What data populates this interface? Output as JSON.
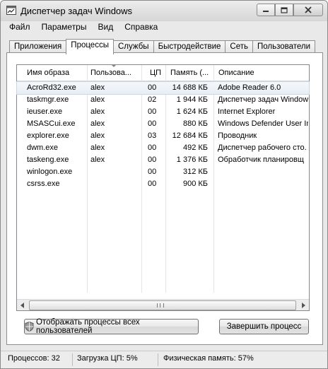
{
  "window": {
    "title": "Диспетчер задач Windows"
  },
  "menu": [
    "Файл",
    "Параметры",
    "Вид",
    "Справка"
  ],
  "tabs": [
    "Приложения",
    "Процессы",
    "Службы",
    "Быстродействие",
    "Сеть",
    "Пользователи"
  ],
  "active_tab": "Процессы",
  "columns": [
    "Имя образа",
    "Пользова...",
    "ЦП",
    "Память (...",
    "Описание"
  ],
  "processes": [
    {
      "name": "AcroRd32.exe",
      "user": "alex",
      "cpu": "00",
      "mem": "14 688 КБ",
      "desc": "Adobe Reader 6.0"
    },
    {
      "name": "taskmgr.exe",
      "user": "alex",
      "cpu": "02",
      "mem": "1 944 КБ",
      "desc": "Диспетчер задач Window"
    },
    {
      "name": "ieuser.exe",
      "user": "alex",
      "cpu": "00",
      "mem": "1 624 КБ",
      "desc": "Internet Explorer"
    },
    {
      "name": "MSASCui.exe",
      "user": "alex",
      "cpu": "00",
      "mem": "880 КБ",
      "desc": "Windows Defender User In"
    },
    {
      "name": "explorer.exe",
      "user": "alex",
      "cpu": "03",
      "mem": "12 684 КБ",
      "desc": "Проводник"
    },
    {
      "name": "dwm.exe",
      "user": "alex",
      "cpu": "00",
      "mem": "492 КБ",
      "desc": "Диспетчер рабочего сто."
    },
    {
      "name": "taskeng.exe",
      "user": "alex",
      "cpu": "00",
      "mem": "1 376 КБ",
      "desc": "Обработчик планировщ"
    },
    {
      "name": "winlogon.exe",
      "user": "",
      "cpu": "00",
      "mem": "312 КБ",
      "desc": ""
    },
    {
      "name": "csrss.exe",
      "user": "",
      "cpu": "00",
      "mem": "900 КБ",
      "desc": ""
    }
  ],
  "buttons": {
    "show_all": "Отображать процессы всех пользователей",
    "end_process": "Завершить процесс"
  },
  "status": {
    "processes": "Процессов: 32",
    "cpu": "Загрузка ЦП: 5%",
    "memory": "Физическая память: 57%"
  }
}
